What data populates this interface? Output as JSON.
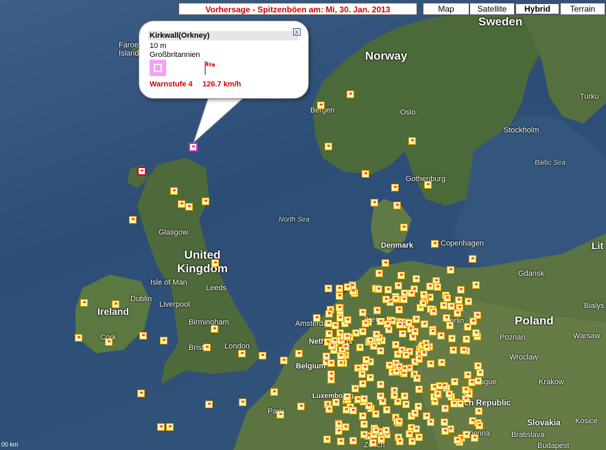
{
  "header": {
    "title": "Vorhersage - Spitzenböen am: Mi, 30. Jan. 2013"
  },
  "map_types": [
    "Map",
    "Satellite",
    "Hybrid",
    "Terrain"
  ],
  "active_map_type": "Hybrid",
  "popup": {
    "station": "Kirkwall(Orkney)",
    "altitude": "10 m",
    "country": "Großbritannien",
    "warning_level": "Warnstufe 4",
    "gust_speed": "126.7  km/h",
    "close_symbol": "X",
    "warning_icon": "warning-level-4-icon",
    "wind_icon": "windsock-icon"
  },
  "labels": {
    "countries": [
      "Sweden",
      "Norway",
      "United Kingdom",
      "Ireland",
      "Denmark",
      "Poland",
      "Czech Republic",
      "Slovakia",
      "Belgium",
      "Netherlands",
      "Luxembourg",
      "Faroe Islands",
      "Lit"
    ],
    "cities": [
      "Bergen",
      "Oslo",
      "Stockholm",
      "Turku",
      "Gothenburg",
      "Glasgow",
      "Isle of Man",
      "Leeds",
      "Dublin",
      "Liverpool",
      "Birmingham",
      "Cork",
      "Bristol",
      "London",
      "Amsterdam",
      "Bremen",
      "Copenhagen",
      "Gdansk",
      "Berlin",
      "Poznan",
      "Warsaw",
      "Bialys",
      "Wroclaw",
      "Krakow",
      "Prague",
      "Paris",
      "Zurich",
      "Vienna",
      "Bratislava",
      "Kosice",
      "Budapest"
    ],
    "seas": [
      "North Sea",
      "Baltic Sea"
    ]
  },
  "scale_label": "00 km",
  "colors": {
    "title_text": "#cc0000",
    "marker_fill": "#ffff9a",
    "marker_border": "#e0a000",
    "warn_level4": "#f5a0f5",
    "water": "#2c4d76"
  }
}
